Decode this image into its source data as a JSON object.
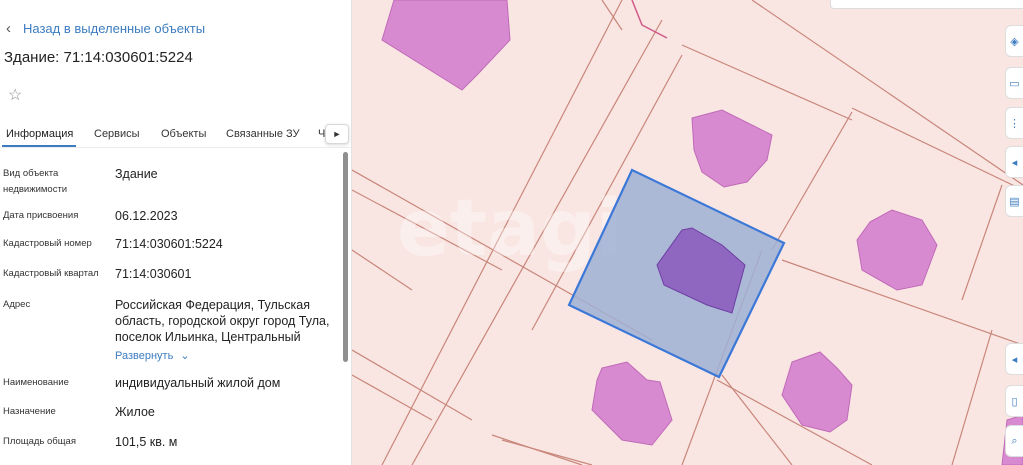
{
  "panel": {
    "back_label": "Назад в выделенные объекты",
    "title": "Здание: 71:14:030601:5224",
    "tabs": [
      {
        "label": "Информация",
        "active": true
      },
      {
        "label": "Сервисы",
        "active": false
      },
      {
        "label": "Объекты",
        "active": false
      },
      {
        "label": "Связанные ЗУ",
        "active": false
      },
      {
        "label": "Ч",
        "active": false
      }
    ],
    "fields": [
      {
        "label": "Вид объекта недвижимости",
        "value": "Здание"
      },
      {
        "label": "Дата присвоения",
        "value": "06.12.2023"
      },
      {
        "label": "Кадастровый номер",
        "value": "71:14:030601:5224"
      },
      {
        "label": "Кадастровый квартал",
        "value": "71:14:030601"
      },
      {
        "label": "Адрес",
        "value": "Российская Федерация, Тульская область, городской округ город Тула, поселок Ильинка, Центральный"
      },
      {
        "label": "Наименование",
        "value": "индивидуальный жилой дом"
      },
      {
        "label": "Назначение",
        "value": "Жилое"
      },
      {
        "label": "Площадь общая",
        "value": "101,5 кв. м"
      }
    ],
    "expand_label": "Развернуть"
  },
  "map": {
    "watermark": "etagi",
    "colors": {
      "background": "#f9e6e3",
      "parcel_line": "#c9867a",
      "building_fill": "#d88ad0",
      "selected_fill": "#9fb0d4",
      "selected_stroke": "#3b78d8",
      "selected_building": "#8f66c0"
    }
  },
  "toolbar": {
    "icons": [
      "layers-icon",
      "ruler-icon",
      "graph-icon",
      "share-icon",
      "print-icon",
      "arrow-icon",
      "panel-icon",
      "search-icon"
    ]
  }
}
